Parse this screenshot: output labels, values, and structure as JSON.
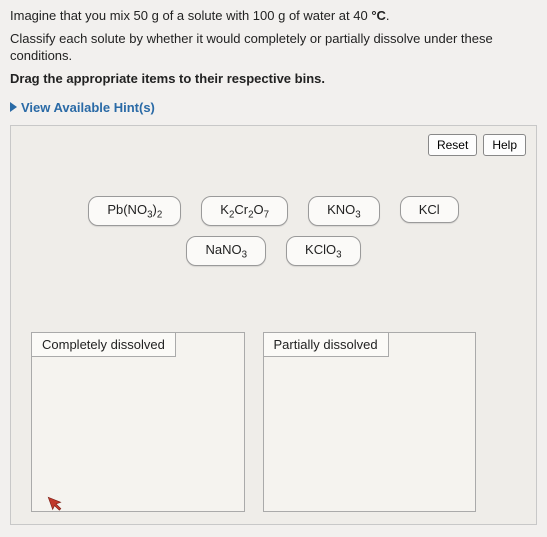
{
  "question": {
    "line1_pre": "Imagine that you mix 50 g of a solute with 100 g of water at 40 ",
    "line1_deg": "°C",
    "line1_post": ".",
    "line2": "Classify each solute by whether it would completely or partially dissolve under these conditions.",
    "line3": "Drag the appropriate items to their respective bins."
  },
  "hints_label": "View Available Hint(s)",
  "buttons": {
    "reset": "Reset",
    "help": "Help"
  },
  "items": {
    "row1": [
      {
        "html": "Pb(NO<sub>3</sub>)<sub>2</sub>",
        "name": "item-pbno32"
      },
      {
        "html": "K<sub>2</sub>Cr<sub>2</sub>O<sub>7</sub>",
        "name": "item-k2cr2o7"
      },
      {
        "html": "KNO<sub>3</sub>",
        "name": "item-kno3"
      },
      {
        "html": "KCl",
        "name": "item-kcl"
      }
    ],
    "row2": [
      {
        "html": "NaNO<sub>3</sub>",
        "name": "item-nano3"
      },
      {
        "html": "KClO<sub>3</sub>",
        "name": "item-kclo3"
      }
    ]
  },
  "bins": {
    "left": "Completely dissolved",
    "right": "Partially dissolved"
  }
}
